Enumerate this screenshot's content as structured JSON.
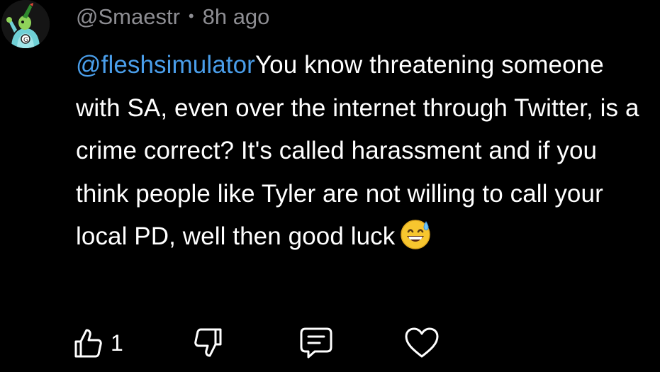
{
  "comment": {
    "username": "@Smaestr",
    "separator": "•",
    "timestamp": "8h ago",
    "mention": "@fleshsimulator",
    "text": "You know threatening someone with SA, even over the internet through Twitter, is a crime correct? It's called harassment and if you think people like Tyler are not willing to call your local PD, well then good luck",
    "emoji": "grinning-face-with-sweat-emoji"
  },
  "actions": {
    "like_icon": "thumbs-up-icon",
    "like_count": "1",
    "dislike_icon": "thumbs-down-icon",
    "reply_icon": "comment-bubble-icon",
    "favorite_icon": "heart-icon"
  },
  "colors": {
    "background": "#000000",
    "text": "#ffffff",
    "meta": "#8e8e93",
    "mention": "#4a9eea"
  }
}
